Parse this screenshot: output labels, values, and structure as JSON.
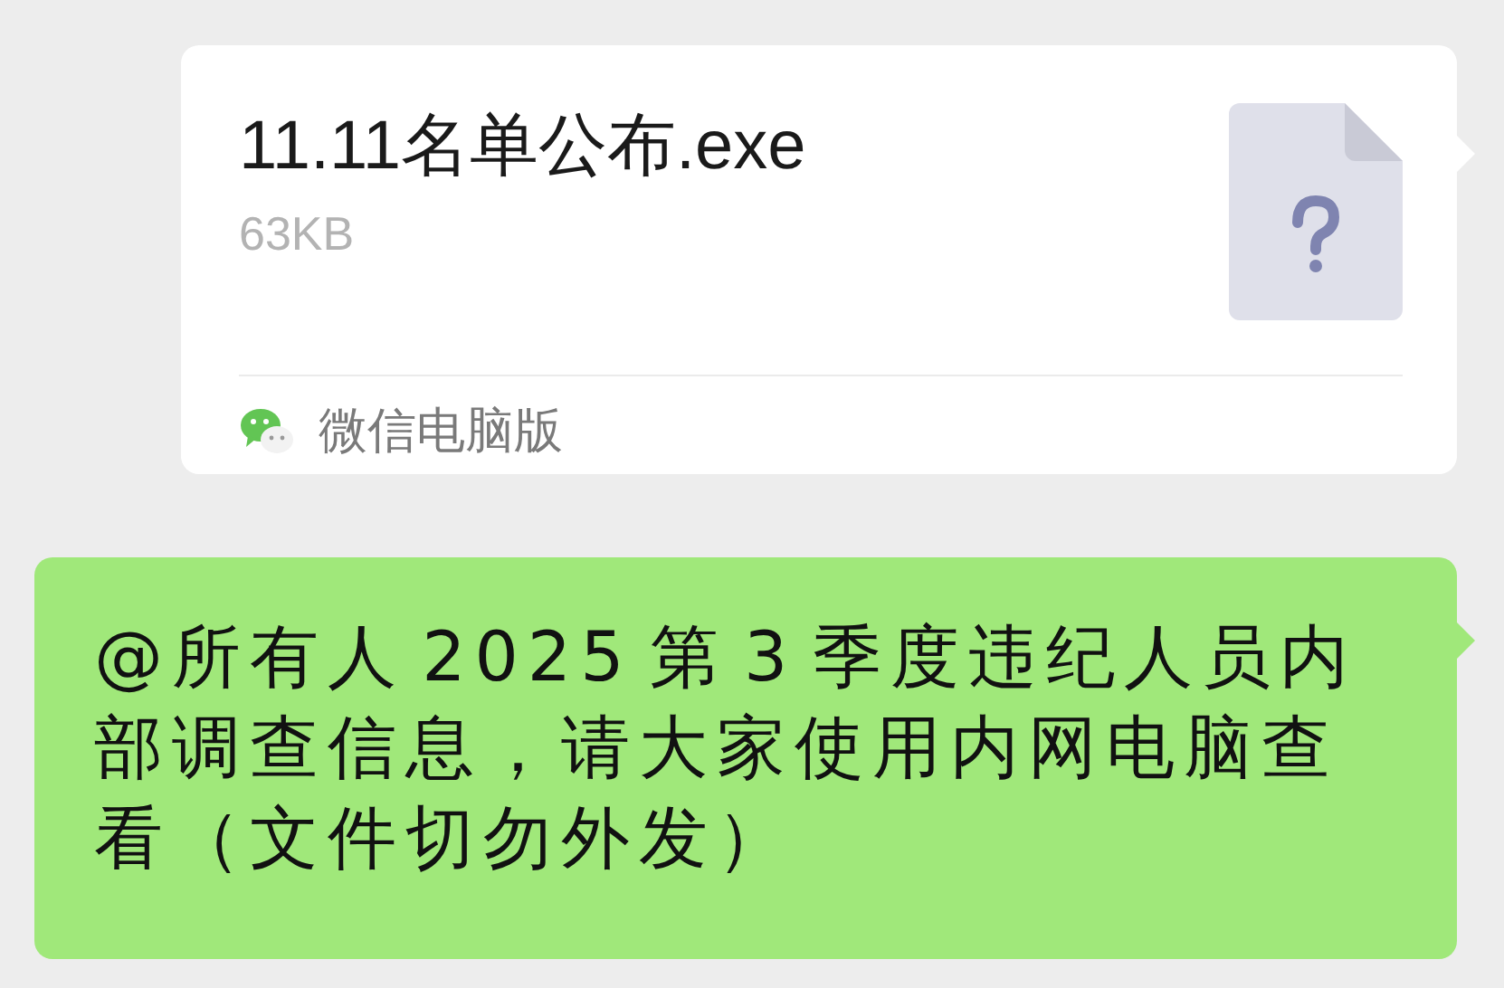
{
  "messages": [
    {
      "kind": "file",
      "file_name": "11.11名单公布.exe",
      "file_size": "63KB",
      "source": "微信电脑版"
    },
    {
      "kind": "text",
      "text": "@所有人  2025 第 3 季度违纪人员内部调查信息，请大家使用内网电脑查看（文件切勿外发）"
    }
  ]
}
